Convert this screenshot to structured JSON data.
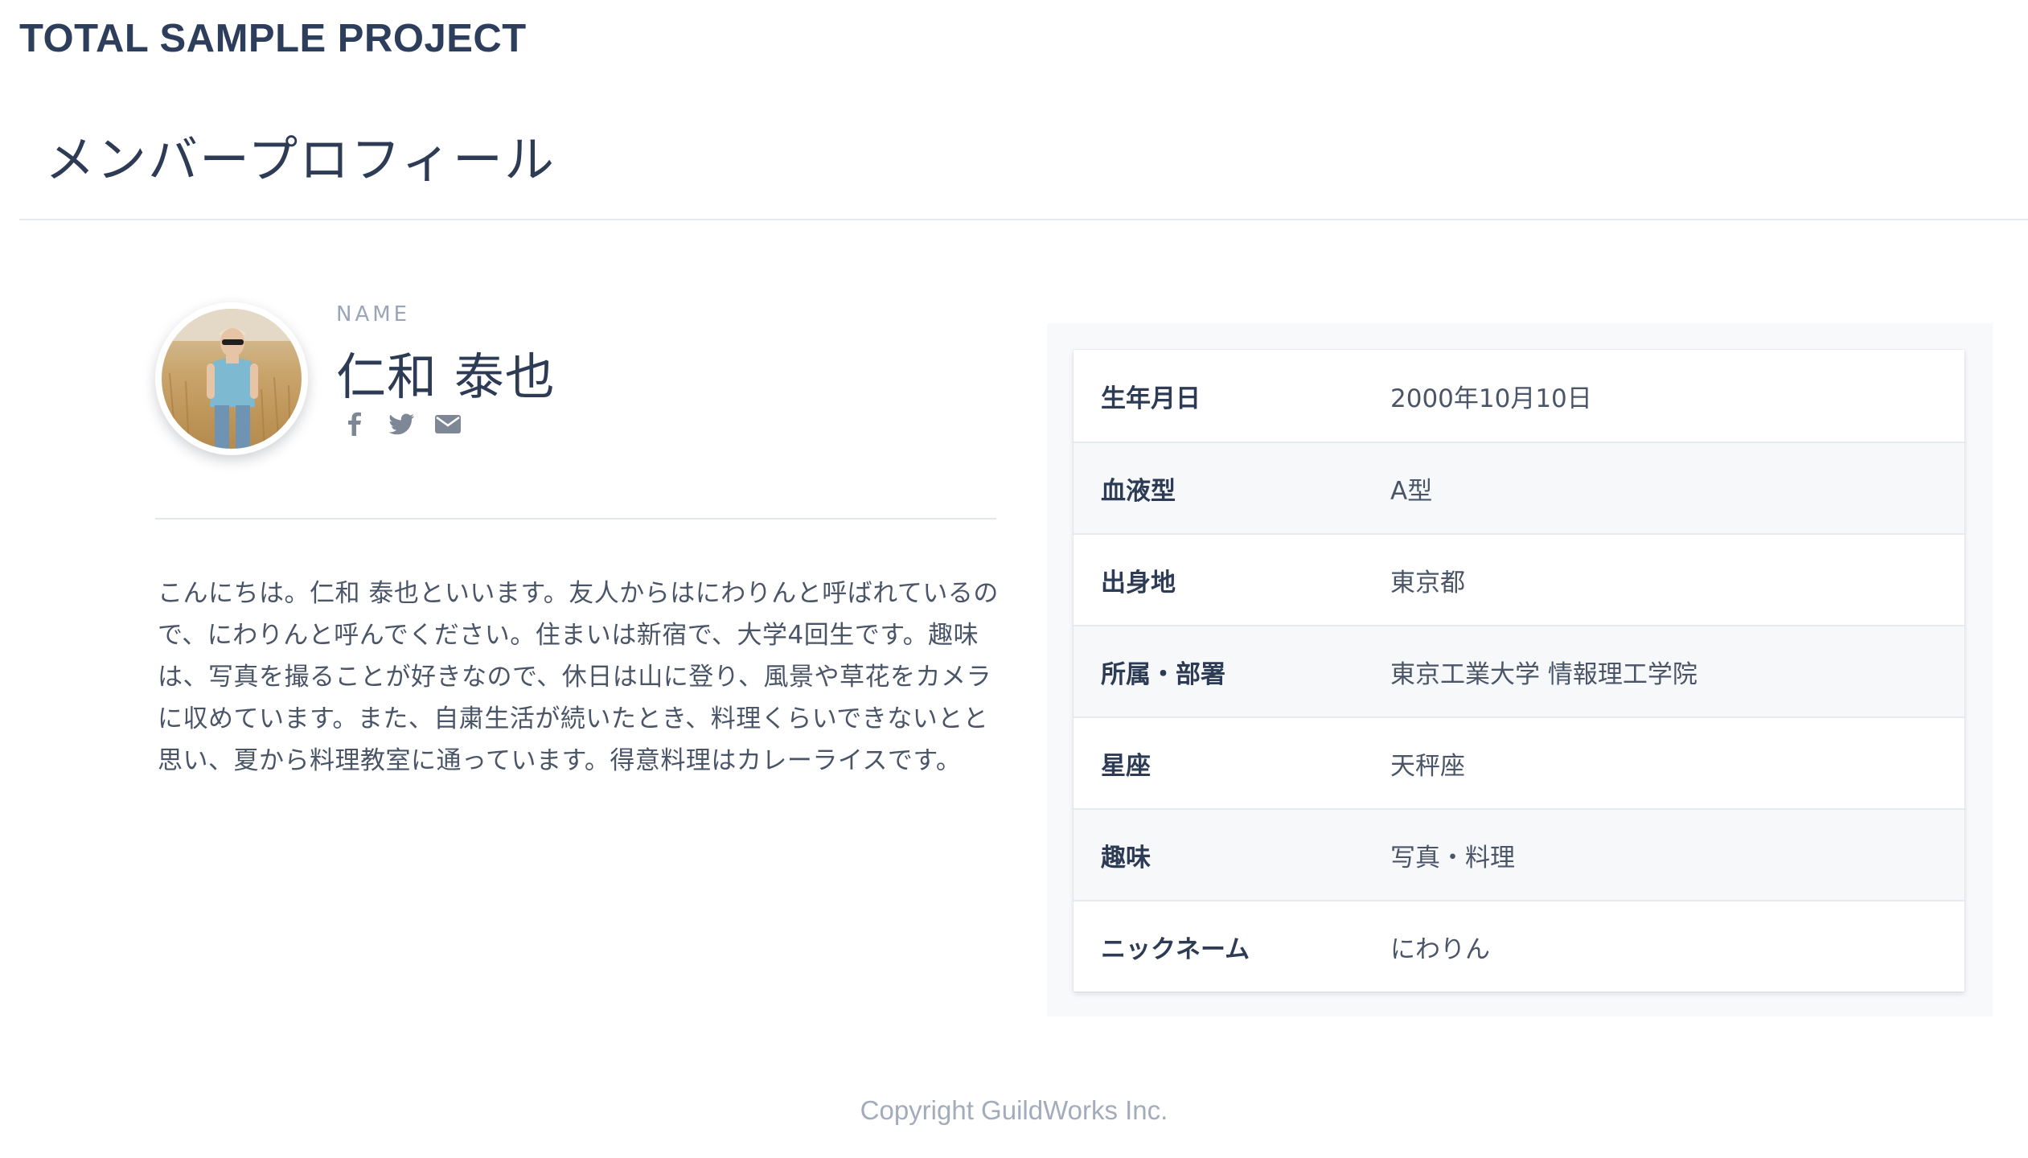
{
  "header": {
    "brand": "TOTAL SAMPLE PROJECT",
    "page_title": "メンバープロフィール"
  },
  "profile": {
    "name_label": "NAME",
    "name": "仁和 泰也",
    "avatar_icon": "avatar-photo",
    "social_icons": [
      "facebook-icon",
      "twitter-icon",
      "mail-icon"
    ],
    "bio": "こんにちは。仁和 泰也といいます。友人からはにわりんと呼ばれているので、にわりんと呼んでください。住まいは新宿で、大学4回生です。趣味は、写真を撮ることが好きなので、休日は山に登り、風景や草花をカメラに収めています。また、自粛生活が続いたとき、料理くらいできないとと思い、夏から料理教室に通っています。得意料理はカレーライスです。"
  },
  "details": {
    "rows": [
      {
        "key": "生年月日",
        "value": "2000年10月10日"
      },
      {
        "key": "血液型",
        "value": "A型"
      },
      {
        "key": "出身地",
        "value": "東京都"
      },
      {
        "key": "所属・部署",
        "value": "東京工業大学 情報理工学院"
      },
      {
        "key": "星座",
        "value": "天秤座"
      },
      {
        "key": "趣味",
        "value": "写真・料理"
      },
      {
        "key": "ニックネーム",
        "value": "にわりん"
      }
    ]
  },
  "footer": {
    "copyright": "Copyright GuildWorks Inc."
  },
  "colors": {
    "text_primary": "#2d3b55",
    "text_muted": "#9aa5b6",
    "panel_bg": "#f8f9fb",
    "divider": "#e5e8ee"
  }
}
